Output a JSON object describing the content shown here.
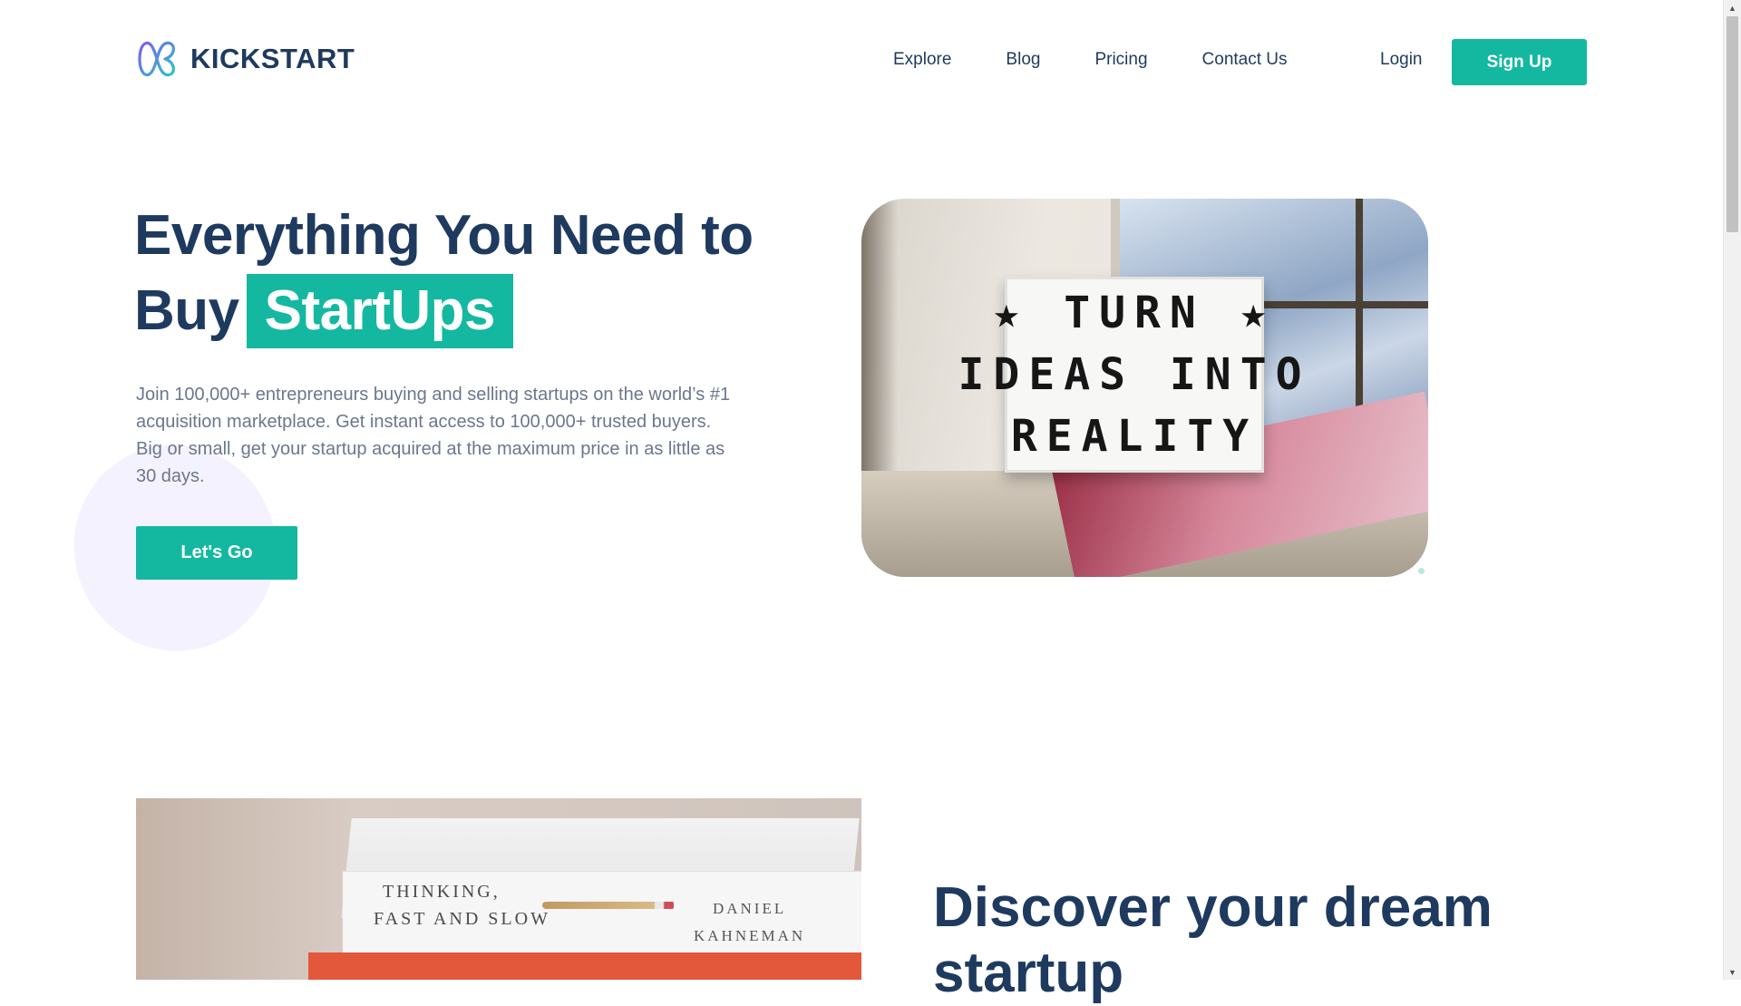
{
  "brand": {
    "name": "KICKSTART",
    "logo_icon": "kickstart-logo-icon"
  },
  "nav": {
    "links": [
      "Explore",
      "Blog",
      "Pricing",
      "Contact Us"
    ],
    "login_label": "Login",
    "signup_label": "Sign Up"
  },
  "hero": {
    "title_line1": "Everything You Need to",
    "title_line2": "Buy",
    "title_highlight": "StartUps",
    "description": "Join 100,000+ entrepreneurs buying and selling startups on the world’s #1 acquisition marketplace. Get instant access to 100,000+ trusted buyers. Big or small, get your startup acquired at the maximum price in as little as 30 days.",
    "cta_label": "Let's Go",
    "image": {
      "lightbox_lines": [
        "★ TURN ★",
        "IDEAS INTO",
        "REALITY"
      ]
    }
  },
  "section2": {
    "title": "Discover your dream startup",
    "image": {
      "book_title_line1": "THINKING,",
      "book_title_line2": "FAST AND SLOW",
      "book_author_line1": "DANIEL",
      "book_author_line2": "KAHNEMAN"
    }
  },
  "colors": {
    "accent": "#14b8a0",
    "heading": "#1f3a5f",
    "body_text": "#6b778c",
    "blob": "#f5f2ff"
  }
}
